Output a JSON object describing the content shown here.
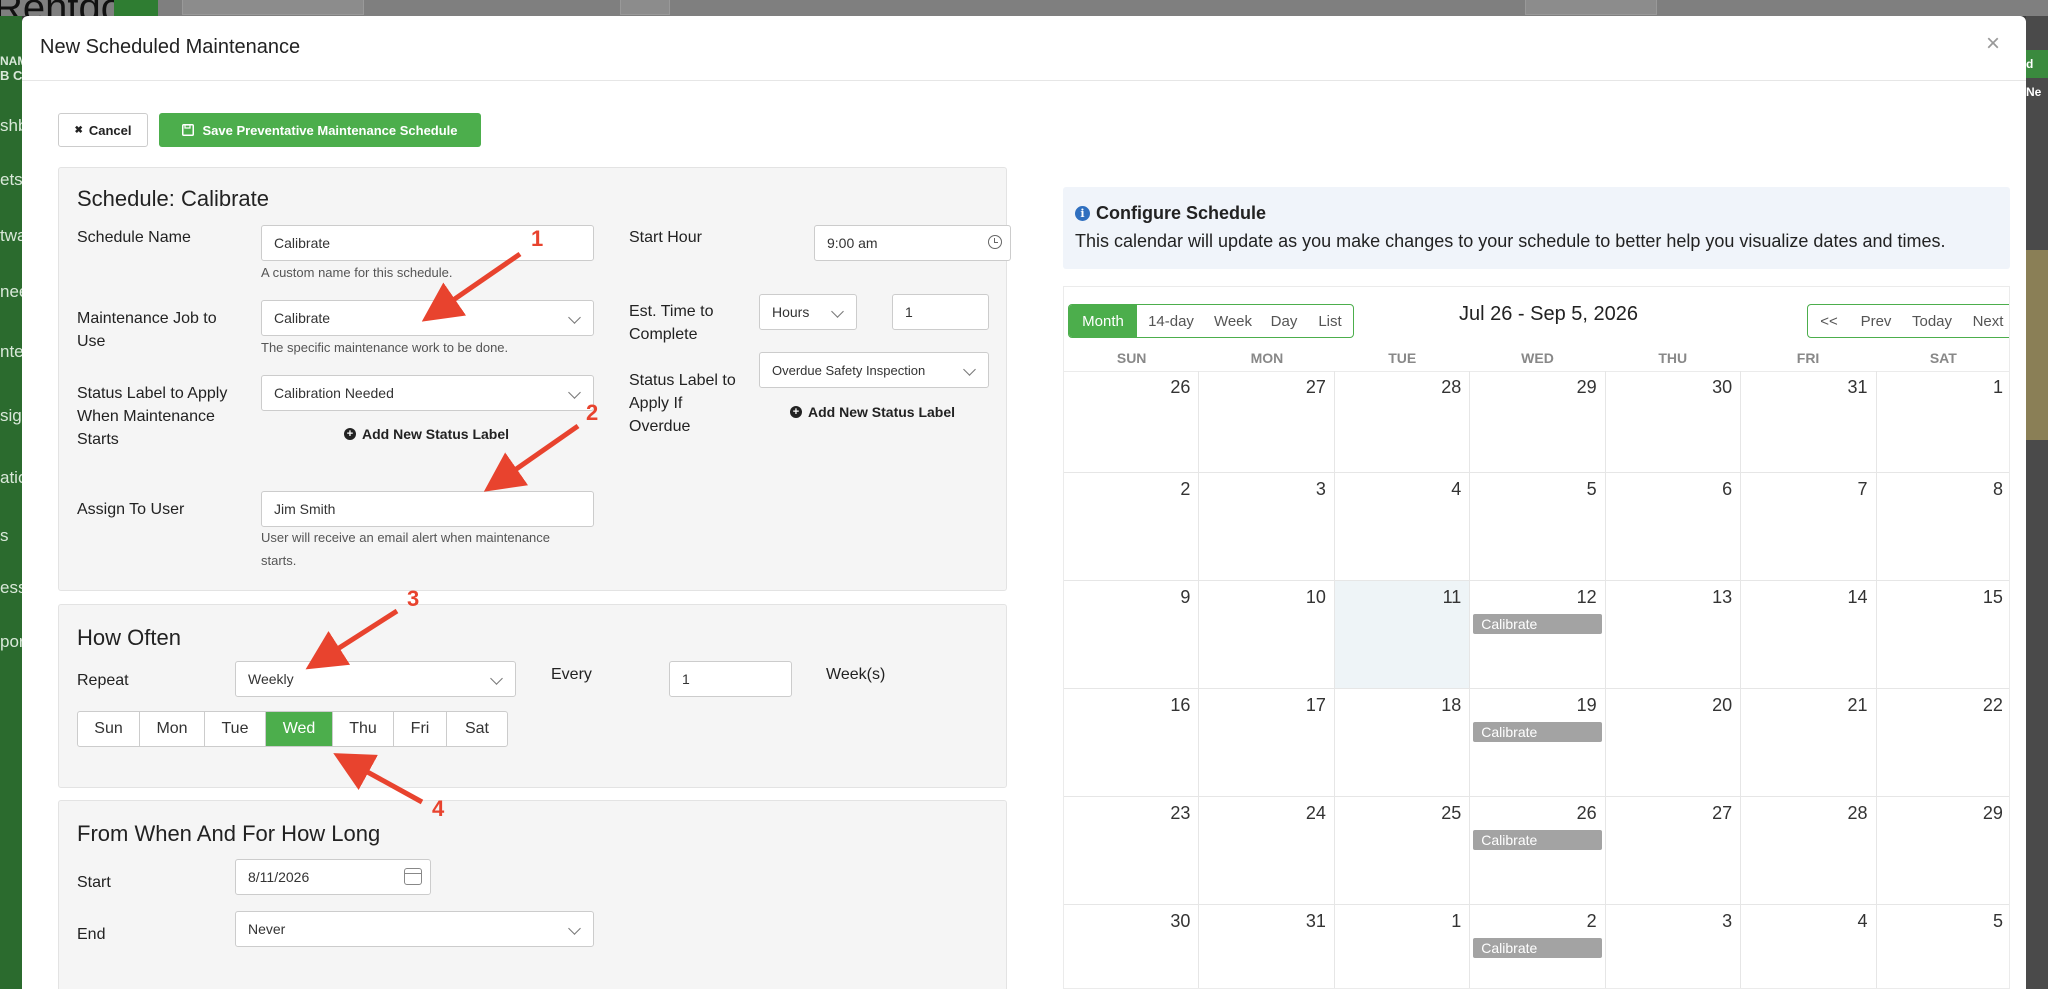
{
  "background": {
    "logo_text": "Rentdo",
    "sidebar_fragments": [
      "NAM",
      "B C",
      "shb",
      "ets",
      "twa",
      "nee",
      "nte",
      "sign",
      "atio",
      "s",
      "ess",
      "port"
    ],
    "right_badge": "d Ne"
  },
  "modal": {
    "title": "New Scheduled Maintenance",
    "close_glyph": "×"
  },
  "toolbar": {
    "cancel_label": "Cancel",
    "cancel_glyph": "✖",
    "save_label": "Save Preventative Maintenance Schedule"
  },
  "schedule": {
    "heading": "Schedule: Calibrate",
    "name_label": "Schedule Name",
    "name_value": "Calibrate",
    "name_help": "A custom name for this schedule.",
    "job_label": "Maintenance Job to Use",
    "job_value": "Calibrate",
    "job_help": "The specific maintenance work to be done.",
    "status_start_label": "Status Label to Apply When Maintenance Starts",
    "status_start_value": "Calibration Needed",
    "add_status_label": "Add New Status Label",
    "assign_label": "Assign To User",
    "assign_value": "Jim Smith",
    "assign_help": "User will receive an email alert when maintenance starts.",
    "start_hour_label": "Start Hour",
    "start_hour_value": "9:00 am",
    "est_time_label": "Est. Time to Complete",
    "est_time_unit": "Hours",
    "est_time_value": "1",
    "overdue_label": "Status Label to Apply If Overdue",
    "overdue_value": "Overdue Safety Inspection",
    "add_status_label_2": "Add New Status Label"
  },
  "how_often": {
    "heading": "How Often",
    "repeat_label": "Repeat",
    "repeat_value": "Weekly",
    "every_label": "Every",
    "every_value": "1",
    "unit_label": "Week(s)",
    "days": [
      "Sun",
      "Mon",
      "Tue",
      "Wed",
      "Thu",
      "Fri",
      "Sat"
    ],
    "selected_day": "Wed"
  },
  "from_when": {
    "heading": "From When And For How Long",
    "start_label": "Start",
    "start_value": "8/11/2026",
    "end_label": "End",
    "end_value": "Never"
  },
  "configure": {
    "title": "Configure Schedule",
    "text": "This calendar will update as you make changes to your schedule to better help you visualize dates and times."
  },
  "calendar": {
    "views": [
      "Month",
      "14-day",
      "Week",
      "Day",
      "List"
    ],
    "active_view": "Month",
    "nav": [
      "<<",
      "Prev",
      "Today",
      "Next",
      ">>"
    ],
    "range_title": "Jul 26 - Sep 5, 2026",
    "weekdays": [
      "SUN",
      "MON",
      "TUE",
      "WED",
      "THU",
      "FRI",
      "SAT"
    ],
    "weeks": [
      [
        "26",
        "27",
        "28",
        "29",
        "30",
        "31",
        "1"
      ],
      [
        "2",
        "3",
        "4",
        "5",
        "6",
        "7",
        "8"
      ],
      [
        "9",
        "10",
        "11",
        "12",
        "13",
        "14",
        "15"
      ],
      [
        "16",
        "17",
        "18",
        "19",
        "20",
        "21",
        "22"
      ],
      [
        "23",
        "24",
        "25",
        "26",
        "27",
        "28",
        "29"
      ],
      [
        "30",
        "31",
        "1",
        "2",
        "3",
        "4",
        "5"
      ]
    ],
    "today": {
      "week": 2,
      "day": 2
    },
    "event_label": "Calibrate",
    "events": [
      {
        "week": 2,
        "day": 3
      },
      {
        "week": 3,
        "day": 3
      },
      {
        "week": 4,
        "day": 3
      },
      {
        "week": 5,
        "day": 3
      }
    ]
  },
  "annotations": [
    "1",
    "2",
    "3",
    "4"
  ],
  "colors": {
    "accent_green": "#4cae4c",
    "annotation_red": "#e8432e",
    "event_gray": "#a3a3a3"
  }
}
